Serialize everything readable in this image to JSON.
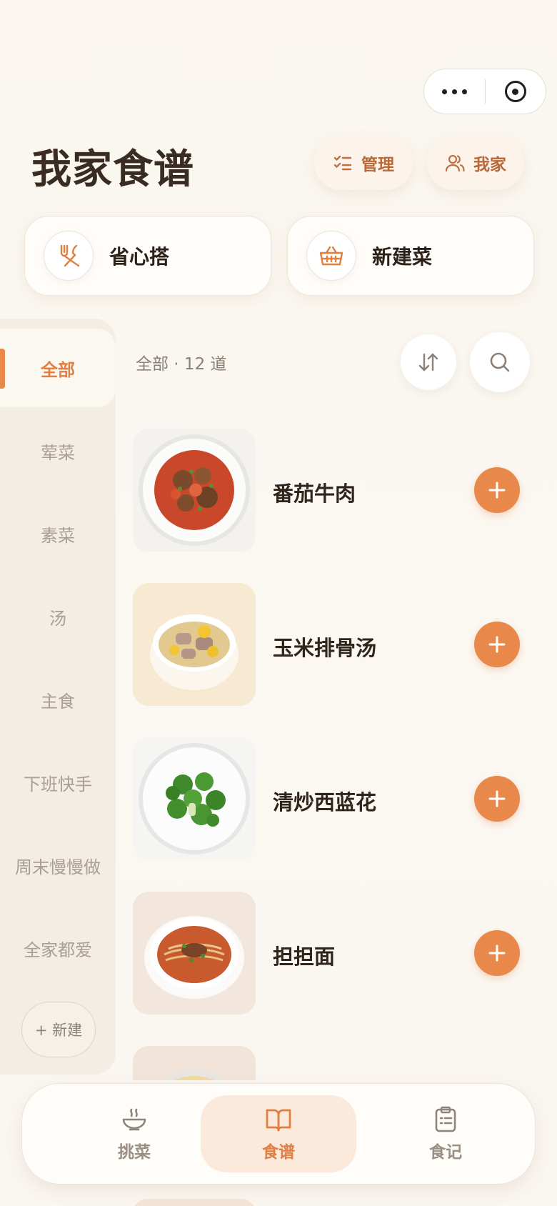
{
  "header": {
    "title": "我家食谱"
  },
  "header_actions": {
    "manage_label": "管理",
    "me_label": "我家"
  },
  "quick_actions": [
    {
      "label": "省心搭",
      "icon": "utensils-icon"
    },
    {
      "label": "新建菜",
      "icon": "basket-icon"
    }
  ],
  "sidebar": {
    "items": [
      {
        "label": "全部",
        "active": true
      },
      {
        "label": "荤菜"
      },
      {
        "label": "素菜"
      },
      {
        "label": "汤"
      },
      {
        "label": "主食"
      },
      {
        "label": "下班快手"
      },
      {
        "label": "周末慢慢做"
      },
      {
        "label": "全家都爱"
      }
    ],
    "new_label": "+ 新建"
  },
  "list": {
    "count_text": "全部 · 12 道",
    "dishes": [
      {
        "name": "番茄牛肉",
        "image": "tomato-beef-photo"
      },
      {
        "name": "玉米排骨汤",
        "image": "corn-rib-soup-photo"
      },
      {
        "name": "清炒西蓝花",
        "image": "broccoli-photo"
      },
      {
        "name": "担担面",
        "image": "dandan-noodles-photo"
      },
      {
        "name": "",
        "image": "fried-rice-photo"
      }
    ]
  },
  "tabbar": {
    "tabs": [
      {
        "label": "挑菜",
        "icon": "bowl-icon"
      },
      {
        "label": "食谱",
        "icon": "book-icon",
        "active": true
      },
      {
        "label": "食记",
        "icon": "clipboard-icon"
      }
    ]
  },
  "colors": {
    "accent": "#e8884a",
    "accent_text": "#e07f3f",
    "background": "#faf6f0"
  }
}
